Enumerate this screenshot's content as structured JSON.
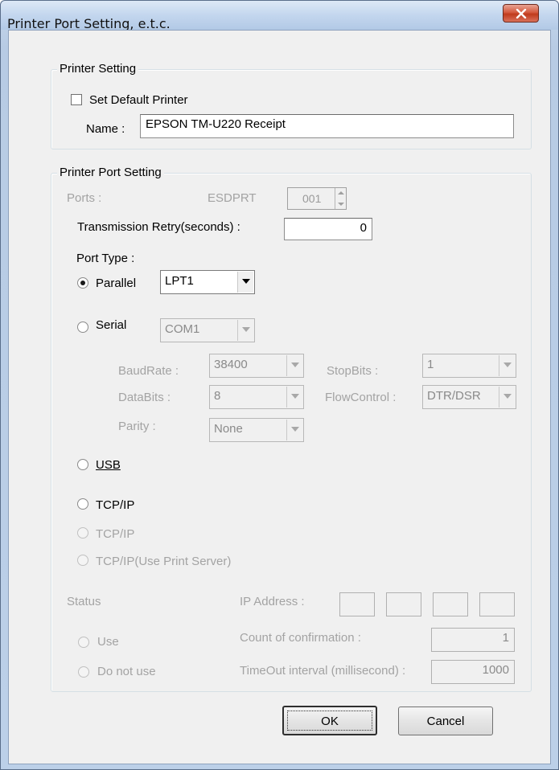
{
  "window": {
    "title": "Printer Port Setting, e.t.c."
  },
  "printer_setting": {
    "legend": "Printer Setting",
    "default_checkbox_label": "Set Default Printer",
    "default_checked": false,
    "name_label": "Name :",
    "name_value": "EPSON TM-U220 Receipt"
  },
  "port_setting": {
    "legend": "Printer Port Setting",
    "ports_label": "Ports :",
    "ports_name": "ESDPRT",
    "ports_value": "001",
    "retry_label": "Transmission Retry(seconds) :",
    "retry_value": "0",
    "port_type_label": "Port Type :",
    "parallel_label": "Parallel",
    "parallel_port": "LPT1",
    "serial_label": "Serial",
    "serial_port": "COM1",
    "baudrate_label": "BaudRate :",
    "baudrate_value": "38400",
    "stopbits_label": "StopBits :",
    "stopbits_value": "1",
    "databits_label": "DataBits :",
    "databits_value": "8",
    "flowcontrol_label": "FlowControl :",
    "flowcontrol_value": "DTR/DSR",
    "parity_label": "Parity :",
    "parity_value": "None",
    "usb_label": "USB",
    "tcpip_label": "TCP/IP",
    "tcpip_sub_label": "TCP/IP",
    "tcpip_server_label": "TCP/IP(Use Print Server)",
    "selected_port_type": "Parallel",
    "status_label": "Status",
    "ip_address_label": "IP Address :",
    "use_label": "Use",
    "do_not_use_label": "Do not use",
    "count_label": "Count of confirmation :",
    "count_value": "1",
    "timeout_label": "TimeOut interval (millisecond) :",
    "timeout_value": "1000"
  },
  "buttons": {
    "ok": "OK",
    "cancel": "Cancel"
  },
  "colors": {
    "title_close": "#c8452a",
    "disabled_text": "#a3a3a3",
    "dialog_bg": "#f0f0f0"
  },
  "icons": {
    "close": "close-icon",
    "dropdown": "chevron-down-icon"
  }
}
